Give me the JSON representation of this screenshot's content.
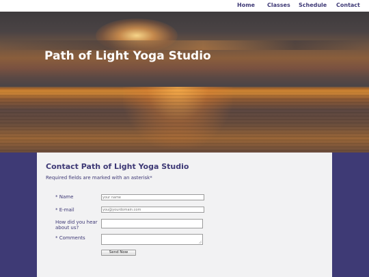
{
  "nav": {
    "items": [
      {
        "label": "Home"
      },
      {
        "label": "Classes"
      },
      {
        "label": "Schedule"
      },
      {
        "label": "Contact"
      }
    ]
  },
  "hero": {
    "title": "Path of Light Yoga Studio"
  },
  "contact": {
    "title": "Contact Path of Light Yoga Studio",
    "required_note": "Required fields are marked with an asterisk*",
    "fields": {
      "name": {
        "label": "* Name",
        "placeholder": "your name",
        "value": ""
      },
      "email": {
        "label": "* E-mail",
        "placeholder": "you@yourdomain.com",
        "value": ""
      },
      "how": {
        "label": "How did you hear about us?",
        "value": ""
      },
      "comments": {
        "label": "* Comments",
        "value": ""
      }
    },
    "submit_label": "Send Now"
  },
  "colors": {
    "accent": "#3d3875",
    "lower_background": "#3e3a75",
    "panel_background": "#f2f2f3"
  }
}
